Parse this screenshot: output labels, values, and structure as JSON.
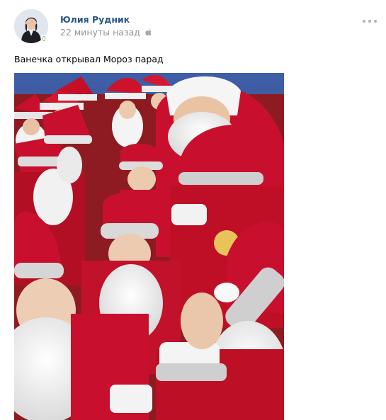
{
  "post": {
    "author": "Юлия Рудник",
    "time": "22 минуты назад",
    "platform_icon": "apple-icon",
    "more_icon": "more-dots-icon",
    "text": "Ванечка открывал Мороз парад",
    "photo_description_icon": "photo-attachment"
  },
  "colors": {
    "link": "#2a5885",
    "meta": "#939393",
    "santa_red": "#c8102e"
  }
}
